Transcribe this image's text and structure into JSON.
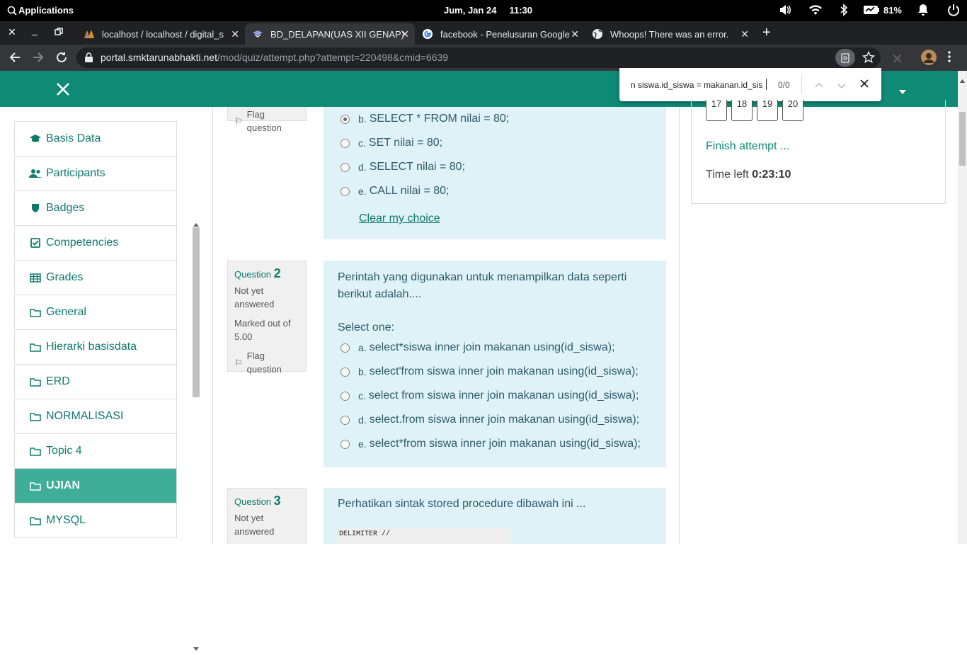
{
  "system": {
    "apps_label": "Applications",
    "clock": "Jum, Jan 24     11:30",
    "battery": "81%"
  },
  "tabs": [
    {
      "title": "localhost / localhost / digital_sign",
      "active": false
    },
    {
      "title": "BD_DELAPAN(UAS XII GENAP)",
      "active": true
    },
    {
      "title": "facebook - Penelusuran Google",
      "active": false
    },
    {
      "title": "Whoops! There was an error.",
      "active": false
    }
  ],
  "address": {
    "host": "portal.smktarunabhakti.net",
    "path": "/mod/quiz/attempt.php?attempt=220498&cmid=6639"
  },
  "find": {
    "query": "n siswa.id_siswa = makanan.id_sis",
    "count": "0/0"
  },
  "sidebar": [
    {
      "label": "Basis Data",
      "icon": "graduation-cap-icon"
    },
    {
      "label": "Participants",
      "icon": "users-icon"
    },
    {
      "label": "Badges",
      "icon": "shield-icon"
    },
    {
      "label": "Competencies",
      "icon": "check-square-icon"
    },
    {
      "label": "Grades",
      "icon": "table-icon"
    },
    {
      "label": "General",
      "icon": "folder-icon"
    },
    {
      "label": "Hierarki basisdata",
      "icon": "folder-icon"
    },
    {
      "label": "ERD",
      "icon": "folder-icon"
    },
    {
      "label": "NORMALISASI",
      "icon": "folder-icon"
    },
    {
      "label": "Topic 4",
      "icon": "folder-icon"
    },
    {
      "label": "UJIAN",
      "icon": "folder-icon",
      "active": true
    },
    {
      "label": "MYSQL",
      "icon": "folder-icon"
    }
  ],
  "q1": {
    "flag": "Flag question",
    "options": [
      {
        "letter": "b.",
        "text": "SELECT * FROM nilai = 80;",
        "checked": true
      },
      {
        "letter": "c.",
        "text": "SET nilai = 80;"
      },
      {
        "letter": "d.",
        "text": "SELECT nilai = 80;"
      },
      {
        "letter": "e.",
        "text": "CALL nilai = 80;"
      }
    ],
    "clear": "Clear my choice"
  },
  "q2": {
    "label": "Question",
    "number": "2",
    "status": "Not yet answered",
    "marks": "Marked out of 5.00",
    "flag": "Flag question",
    "text": "Perintah yang digunakan untuk menampilkan data seperti berikut adalah....",
    "select_one": "Select one:",
    "options": [
      {
        "letter": "a.",
        "text": "select*siswa inner join makanan using(id_siswa);"
      },
      {
        "letter": "b.",
        "text": "select'from siswa inner join makanan using(id_siswa);"
      },
      {
        "letter": "c.",
        "text": "select from siswa inner join makanan using(id_siswa);"
      },
      {
        "letter": "d.",
        "text": "select.from siswa inner join makanan using(id_siswa);"
      },
      {
        "letter": "e.",
        "text": "select*from siswa inner join makanan using(id_siswa);"
      }
    ]
  },
  "q3": {
    "label": "Question",
    "number": "3",
    "status": "Not yet answered",
    "text": "Perhatikan sintak stored procedure dibawah ini ...",
    "code": "DELIMITER //"
  },
  "quiznav": {
    "boxes": [
      "17",
      "18",
      "19",
      "20"
    ],
    "finish": "Finish attempt ...",
    "time_label": "Time left",
    "time_value": "0:23:10"
  }
}
